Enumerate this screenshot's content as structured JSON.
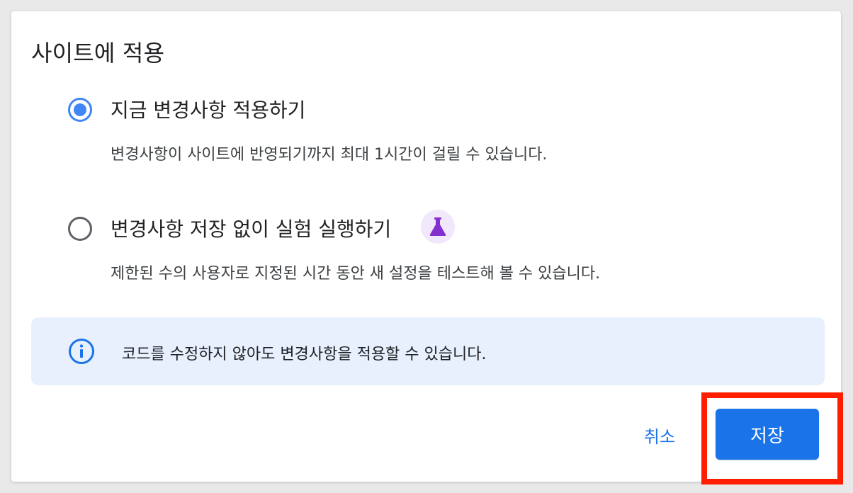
{
  "dialog": {
    "title": "사이트에 적용",
    "options": [
      {
        "label": "지금 변경사항 적용하기",
        "description": "변경사항이 사이트에 반영되기까지 최대 1시간이 걸릴 수 있습니다.",
        "selected": true
      },
      {
        "label": "변경사항 저장 없이 실험 실행하기",
        "description": "제한된 수의 사용자로 지정된 시간 동안 새 설정을 테스트해 볼 수 있습니다.",
        "selected": false,
        "badge_icon": "flask-icon"
      }
    ],
    "info": {
      "icon": "info-icon",
      "text": "코드를 수정하지 않아도 변경사항을 적용할 수 있습니다."
    },
    "actions": {
      "cancel_label": "취소",
      "save_label": "저장"
    }
  },
  "colors": {
    "accent": "#1a73e8",
    "radio_selected": "#4285f4",
    "info_background": "#e8f0fe",
    "flask_badge_background": "#f1e8fb",
    "flask_icon": "#8430ce",
    "highlight": "#ff1f00"
  }
}
